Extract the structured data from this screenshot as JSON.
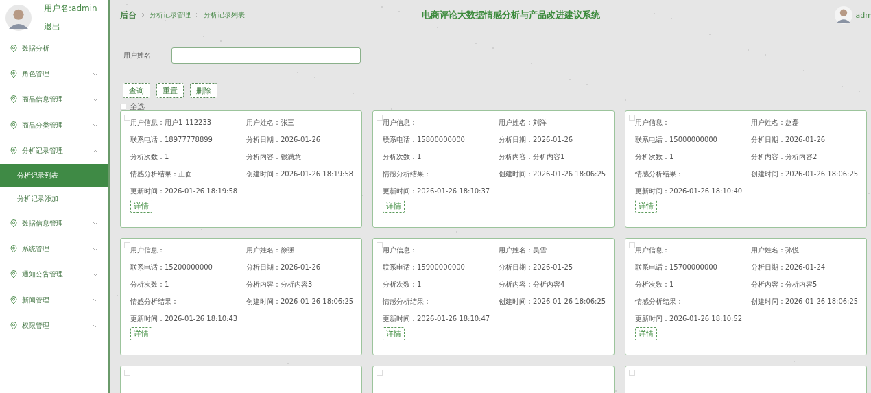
{
  "user": {
    "label": "用户名:admin",
    "logout": "退出"
  },
  "sidebar": {
    "items": [
      {
        "label": "数据分析"
      },
      {
        "label": "角色管理",
        "expanded": false
      },
      {
        "label": "商品信息管理",
        "expanded": false
      },
      {
        "label": "商品分类管理",
        "expanded": false
      },
      {
        "label": "分析记录管理",
        "expanded": true,
        "children": [
          {
            "label": "分析记录列表",
            "selected": true
          },
          {
            "label": "分析记录添加",
            "selected": false
          }
        ]
      },
      {
        "label": "数据信息管理",
        "expanded": false
      },
      {
        "label": "系统管理",
        "expanded": false
      },
      {
        "label": "通知公告管理",
        "expanded": false
      },
      {
        "label": "新闻管理",
        "expanded": false
      },
      {
        "label": "权限管理",
        "expanded": false
      }
    ]
  },
  "breadcrumb": [
    "后台",
    "分析记录管理",
    "分析记录列表"
  ],
  "title": "电商评论大数据情感分析与产品改进建议系统",
  "top_user": "adm",
  "search": {
    "label": "用户姓名"
  },
  "buttons": [
    "查询",
    "重置",
    "删除"
  ],
  "select_all": {
    "label": "全选",
    "checked": false
  },
  "cards": [
    {
      "checked": false,
      "fields": [
        {
          "label": "用户信息：",
          "value": "用户1-112233"
        },
        {
          "label": "用户姓名：",
          "value": "张三"
        },
        {
          "label": "联系电话：",
          "value": "18977778899"
        },
        {
          "label": "分析日期：",
          "value": "2026-01-26"
        },
        {
          "label": "分析次数：",
          "value": "1"
        },
        {
          "label": "分析内容：",
          "value": "很满意"
        },
        {
          "label": "情感分析结果：",
          "value": "正面"
        },
        {
          "label": "创建时间：",
          "value": "2026-01-26 18:19:58"
        },
        {
          "label": "更新时间：",
          "value": "2026-01-26 18:19:58"
        }
      ],
      "button": "详情"
    },
    {
      "checked": false,
      "fields": [
        {
          "label": "用户信息："
        },
        {
          "label": "用户姓名：",
          "value": "刘洋"
        },
        {
          "label": "联系电话：",
          "value": "15800000000"
        },
        {
          "label": "分析日期：",
          "value": "2026-01-26"
        },
        {
          "label": "分析次数：",
          "value": "1"
        },
        {
          "label": "分析内容：",
          "value": "分析内容1"
        },
        {
          "label": "情感分析结果："
        },
        {
          "label": "创建时间：",
          "value": "2026-01-26 18:06:25"
        },
        {
          "label": "更新时间：",
          "value": "2026-01-26 18:10:37"
        }
      ],
      "button": "详情"
    },
    {
      "checked": false,
      "fields": [
        {
          "label": "用户信息："
        },
        {
          "label": "用户姓名：",
          "value": "赵磊"
        },
        {
          "label": "联系电话：",
          "value": "15000000000"
        },
        {
          "label": "分析日期：",
          "value": "2026-01-26"
        },
        {
          "label": "分析次数：",
          "value": "1"
        },
        {
          "label": "分析内容：",
          "value": "分析内容2"
        },
        {
          "label": "情感分析结果："
        },
        {
          "label": "创建时间：",
          "value": "2026-01-26 18:06:25"
        },
        {
          "label": "更新时间：",
          "value": "2026-01-26 18:10:40"
        }
      ],
      "button": "详情"
    },
    {
      "checked": false,
      "fields": [
        {
          "label": "用户信息："
        },
        {
          "label": "用户姓名：",
          "value": "徐强"
        },
        {
          "label": "联系电话：",
          "value": "15200000000"
        },
        {
          "label": "分析日期：",
          "value": "2026-01-26"
        },
        {
          "label": "分析次数：",
          "value": "1"
        },
        {
          "label": "分析内容：",
          "value": "分析内容3"
        },
        {
          "label": "情感分析结果："
        },
        {
          "label": "创建时间：",
          "value": "2026-01-26 18:06:25"
        },
        {
          "label": "更新时间：",
          "value": "2026-01-26 18:10:43"
        }
      ],
      "button": "详情"
    },
    {
      "checked": false,
      "fields": [
        {
          "label": "用户信息："
        },
        {
          "label": "用户姓名：",
          "value": "吴雪"
        },
        {
          "label": "联系电话：",
          "value": "15900000000"
        },
        {
          "label": "分析日期：",
          "value": "2026-01-25"
        },
        {
          "label": "分析次数：",
          "value": "1"
        },
        {
          "label": "分析内容：",
          "value": "分析内容4"
        },
        {
          "label": "情感分析结果："
        },
        {
          "label": "创建时间：",
          "value": "2026-01-26 18:06:25"
        },
        {
          "label": "更新时间：",
          "value": "2026-01-26 18:10:47"
        }
      ],
      "button": "详情"
    },
    {
      "checked": false,
      "fields": [
        {
          "label": "用户信息："
        },
        {
          "label": "用户姓名：",
          "value": "孙悦"
        },
        {
          "label": "联系电话：",
          "value": "15700000000"
        },
        {
          "label": "分析日期：",
          "value": "2026-01-24"
        },
        {
          "label": "分析次数：",
          "value": "1"
        },
        {
          "label": "分析内容：",
          "value": "分析内容5"
        },
        {
          "label": "情感分析结果："
        },
        {
          "label": "创建时间：",
          "value": "2026-01-26 18:06:25"
        },
        {
          "label": "更新时间：",
          "value": "2026-01-26 18:10:52"
        }
      ],
      "button": "详情"
    },
    {
      "checked": false
    },
    {
      "checked": false
    },
    {
      "checked": false
    }
  ]
}
